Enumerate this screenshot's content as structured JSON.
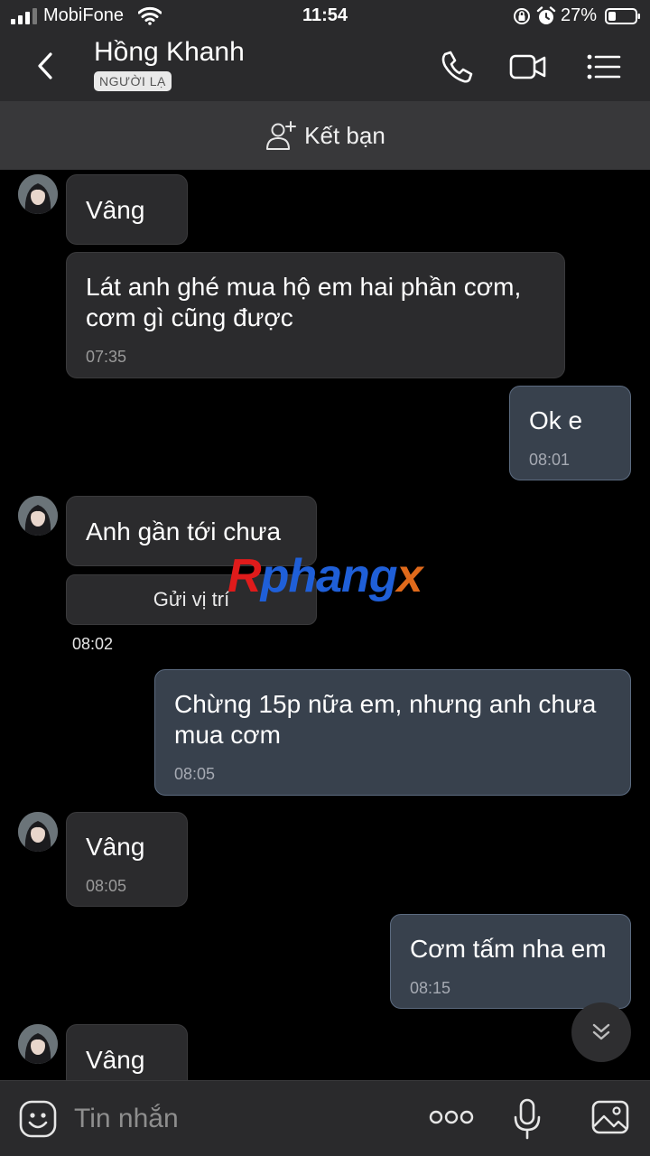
{
  "status_bar": {
    "carrier": "MobiFone",
    "time": "11:54",
    "battery": "27%"
  },
  "header": {
    "contact_name": "Hồng Khanh",
    "badge": "NGƯỜI LẠ"
  },
  "add_friend": {
    "label": "Kết bạn"
  },
  "messages": [
    {
      "from": "contact",
      "text": "Vâng",
      "time": ""
    },
    {
      "from": "contact",
      "text": "Lát anh ghé mua hộ em hai phần cơm, cơm gì cũng được",
      "time": "07:35"
    },
    {
      "from": "me",
      "text": "Ok e",
      "time": "08:01"
    },
    {
      "from": "contact",
      "text": "Anh gần tới chưa",
      "time": ""
    },
    {
      "from": "me",
      "text": "Chừng 15p nữa em, nhưng anh chưa mua cơm",
      "time": "08:05"
    },
    {
      "from": "contact",
      "text": "Vâng",
      "time": "08:05"
    },
    {
      "from": "me",
      "text": "Cơm tấm nha em",
      "time": "08:15"
    },
    {
      "from": "contact",
      "text": "Vâng",
      "time": ""
    }
  ],
  "location": {
    "button_label": "Gửi vị trí",
    "time": "08:02"
  },
  "watermark": {
    "part1": "R",
    "part2": "phang",
    "part3": "x"
  },
  "input": {
    "placeholder": "Tin nhắn"
  },
  "icons": {
    "back": "chevron-left-icon",
    "call": "phone-icon",
    "video": "video-camera-icon",
    "menu": "list-menu-icon",
    "add_friend": "add-user-icon",
    "emoji": "emoji-icon",
    "more": "more-dots-icon",
    "mic": "microphone-icon",
    "image": "image-icon",
    "scroll": "double-chevron-down-icon"
  },
  "colors": {
    "background": "#000000",
    "incoming_bubble": "#2b2b2d",
    "outgoing_bubble": "#38414d",
    "outgoing_border": "#5c6b80"
  }
}
